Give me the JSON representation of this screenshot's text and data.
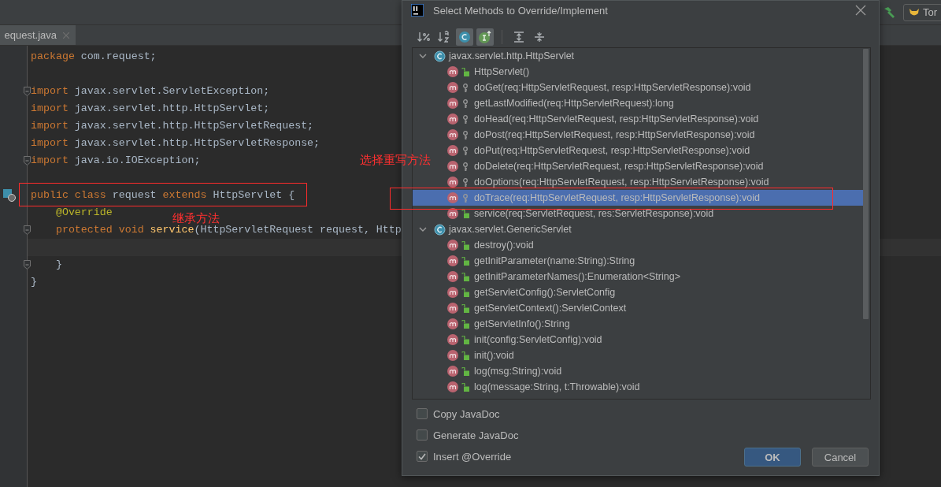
{
  "toolbar": {
    "run_config": "Tor"
  },
  "editor_tabs": [
    {
      "label": "equest.java",
      "selected": true
    }
  ],
  "code_lines": [
    {
      "kind": "code",
      "current": false,
      "fold": false,
      "run_marker": false,
      "tokens": [
        {
          "kind": "keyword",
          "text": "package"
        },
        {
          "kind": "plain",
          "text": " com.request;"
        }
      ]
    },
    {
      "kind": "blank",
      "current": false,
      "fold": false,
      "run_marker": false
    },
    {
      "kind": "code",
      "current": false,
      "fold": true,
      "run_marker": false,
      "tokens": [
        {
          "kind": "keyword",
          "text": "import"
        },
        {
          "kind": "plain",
          "text": " javax.servlet.ServletException;"
        }
      ]
    },
    {
      "kind": "code",
      "current": false,
      "fold": false,
      "run_marker": false,
      "tokens": [
        {
          "kind": "keyword",
          "text": "import"
        },
        {
          "kind": "plain",
          "text": " javax.servlet.http.HttpServlet;"
        }
      ]
    },
    {
      "kind": "code",
      "current": false,
      "fold": false,
      "run_marker": false,
      "tokens": [
        {
          "kind": "keyword",
          "text": "import"
        },
        {
          "kind": "plain",
          "text": " javax.servlet.http.HttpServletRequest;"
        }
      ]
    },
    {
      "kind": "code",
      "current": false,
      "fold": false,
      "run_marker": false,
      "tokens": [
        {
          "kind": "keyword",
          "text": "import"
        },
        {
          "kind": "plain",
          "text": " javax.servlet.http.HttpServletResponse;"
        }
      ]
    },
    {
      "kind": "code",
      "current": false,
      "fold": true,
      "run_marker": false,
      "tokens": [
        {
          "kind": "keyword",
          "text": "import"
        },
        {
          "kind": "plain",
          "text": " java.io.IOException;"
        }
      ]
    },
    {
      "kind": "blank",
      "current": false,
      "fold": false,
      "run_marker": false
    },
    {
      "kind": "code",
      "current": false,
      "fold": false,
      "run_marker": true,
      "tokens": [
        {
          "kind": "keyword",
          "text": "public class "
        },
        {
          "kind": "plain",
          "text": "request "
        },
        {
          "kind": "keyword",
          "text": "extends "
        },
        {
          "kind": "plain",
          "text": "HttpServlet {"
        }
      ]
    },
    {
      "kind": "code",
      "current": false,
      "fold": false,
      "run_marker": false,
      "tokens": [
        {
          "kind": "annotation",
          "text": "    @Override"
        }
      ]
    },
    {
      "kind": "code",
      "current": false,
      "fold": true,
      "run_marker": false,
      "tokens": [
        {
          "kind": "keyword",
          "text": "    protected void "
        },
        {
          "kind": "method",
          "text": "service"
        },
        {
          "kind": "plain",
          "text": "(HttpServletRequest request, Http"
        }
      ]
    },
    {
      "kind": "blank",
      "current": true,
      "fold": false,
      "run_marker": false
    },
    {
      "kind": "code",
      "current": false,
      "fold": true,
      "run_marker": false,
      "tokens": [
        {
          "kind": "plain",
          "text": "    }"
        }
      ]
    },
    {
      "kind": "code",
      "current": false,
      "fold": false,
      "run_marker": false,
      "tokens": [
        {
          "kind": "plain",
          "text": "}"
        }
      ]
    }
  ],
  "notes": [
    {
      "text": "继承方法"
    },
    {
      "text": "选择重写方法"
    }
  ],
  "dialog": {
    "title": "Select Methods to Override/Implement",
    "toolbar": [
      {
        "kind": "sort-visibility",
        "selected": false
      },
      {
        "kind": "sort-alpha",
        "selected": false
      },
      {
        "kind": "class",
        "selected": true
      },
      {
        "kind": "interface",
        "selected": true
      },
      {
        "kind": "expand",
        "selected": false
      },
      {
        "kind": "collapse",
        "selected": false
      }
    ],
    "tree": [
      {
        "label": "javax.servlet.http.HttpServlet",
        "expanded": true,
        "children": [
          {
            "label": "HttpServlet()",
            "kind": "public",
            "selected": false
          },
          {
            "label": "doGet(req:HttpServletRequest, resp:HttpServletResponse):void",
            "kind": "protected",
            "selected": false
          },
          {
            "label": "getLastModified(req:HttpServletRequest):long",
            "kind": "protected",
            "selected": false
          },
          {
            "label": "doHead(req:HttpServletRequest, resp:HttpServletResponse):void",
            "kind": "protected",
            "selected": false
          },
          {
            "label": "doPost(req:HttpServletRequest, resp:HttpServletResponse):void",
            "kind": "protected",
            "selected": false
          },
          {
            "label": "doPut(req:HttpServletRequest, resp:HttpServletResponse):void",
            "kind": "protected",
            "selected": false
          },
          {
            "label": "doDelete(req:HttpServletRequest, resp:HttpServletResponse):void",
            "kind": "protected",
            "selected": false
          },
          {
            "label": "doOptions(req:HttpServletRequest, resp:HttpServletResponse):void",
            "kind": "protected",
            "selected": false
          },
          {
            "label": "doTrace(req:HttpServletRequest, resp:HttpServletResponse):void",
            "kind": "protected",
            "selected": true
          },
          {
            "label": "service(req:ServletRequest, res:ServletResponse):void",
            "kind": "public",
            "selected": false
          }
        ]
      },
      {
        "label": "javax.servlet.GenericServlet",
        "expanded": true,
        "children": [
          {
            "label": "destroy():void",
            "kind": "public",
            "selected": false
          },
          {
            "label": "getInitParameter(name:String):String",
            "kind": "public",
            "selected": false
          },
          {
            "label": "getInitParameterNames():Enumeration<String>",
            "kind": "public",
            "selected": false
          },
          {
            "label": "getServletConfig():ServletConfig",
            "kind": "public",
            "selected": false
          },
          {
            "label": "getServletContext():ServletContext",
            "kind": "public",
            "selected": false
          },
          {
            "label": "getServletInfo():String",
            "kind": "public",
            "selected": false
          },
          {
            "label": "init(config:ServletConfig):void",
            "kind": "public",
            "selected": false
          },
          {
            "label": "init():void",
            "kind": "public",
            "selected": false
          },
          {
            "label": "log(msg:String):void",
            "kind": "public",
            "selected": false
          },
          {
            "label": "log(message:String, t:Throwable):void",
            "kind": "public",
            "selected": false
          }
        ]
      }
    ],
    "options": [
      {
        "label": "Copy JavaDoc",
        "checked": false
      },
      {
        "label": "Generate JavaDoc",
        "checked": false
      },
      {
        "label": "Insert @Override",
        "checked": true
      }
    ],
    "buttons": [
      {
        "label": "OK",
        "kind": "primary"
      },
      {
        "label": "Cancel",
        "kind": "secondary"
      }
    ]
  }
}
